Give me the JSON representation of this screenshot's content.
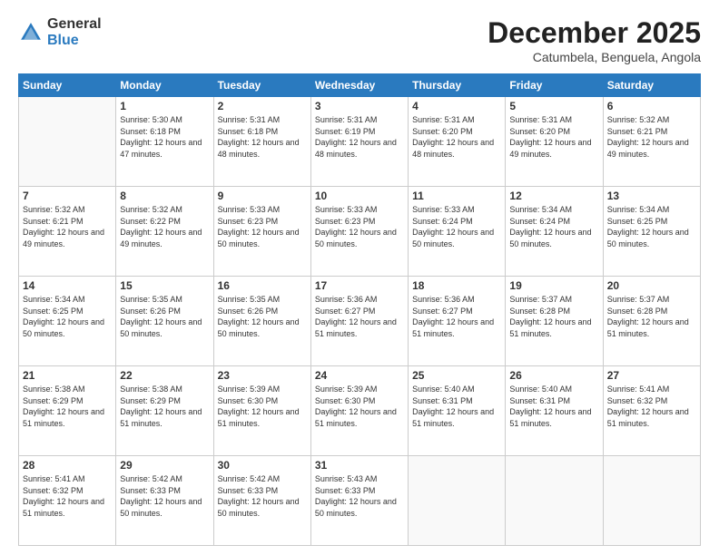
{
  "logo": {
    "general": "General",
    "blue": "Blue"
  },
  "header": {
    "month": "December 2025",
    "location": "Catumbela, Benguela, Angola"
  },
  "days": [
    "Sunday",
    "Monday",
    "Tuesday",
    "Wednesday",
    "Thursday",
    "Friday",
    "Saturday"
  ],
  "weeks": [
    [
      {
        "num": "",
        "sunrise": "",
        "sunset": "",
        "daylight": ""
      },
      {
        "num": "1",
        "sunrise": "Sunrise: 5:30 AM",
        "sunset": "Sunset: 6:18 PM",
        "daylight": "Daylight: 12 hours and 47 minutes."
      },
      {
        "num": "2",
        "sunrise": "Sunrise: 5:31 AM",
        "sunset": "Sunset: 6:18 PM",
        "daylight": "Daylight: 12 hours and 48 minutes."
      },
      {
        "num": "3",
        "sunrise": "Sunrise: 5:31 AM",
        "sunset": "Sunset: 6:19 PM",
        "daylight": "Daylight: 12 hours and 48 minutes."
      },
      {
        "num": "4",
        "sunrise": "Sunrise: 5:31 AM",
        "sunset": "Sunset: 6:20 PM",
        "daylight": "Daylight: 12 hours and 48 minutes."
      },
      {
        "num": "5",
        "sunrise": "Sunrise: 5:31 AM",
        "sunset": "Sunset: 6:20 PM",
        "daylight": "Daylight: 12 hours and 49 minutes."
      },
      {
        "num": "6",
        "sunrise": "Sunrise: 5:32 AM",
        "sunset": "Sunset: 6:21 PM",
        "daylight": "Daylight: 12 hours and 49 minutes."
      }
    ],
    [
      {
        "num": "7",
        "sunrise": "Sunrise: 5:32 AM",
        "sunset": "Sunset: 6:21 PM",
        "daylight": "Daylight: 12 hours and 49 minutes."
      },
      {
        "num": "8",
        "sunrise": "Sunrise: 5:32 AM",
        "sunset": "Sunset: 6:22 PM",
        "daylight": "Daylight: 12 hours and 49 minutes."
      },
      {
        "num": "9",
        "sunrise": "Sunrise: 5:33 AM",
        "sunset": "Sunset: 6:23 PM",
        "daylight": "Daylight: 12 hours and 50 minutes."
      },
      {
        "num": "10",
        "sunrise": "Sunrise: 5:33 AM",
        "sunset": "Sunset: 6:23 PM",
        "daylight": "Daylight: 12 hours and 50 minutes."
      },
      {
        "num": "11",
        "sunrise": "Sunrise: 5:33 AM",
        "sunset": "Sunset: 6:24 PM",
        "daylight": "Daylight: 12 hours and 50 minutes."
      },
      {
        "num": "12",
        "sunrise": "Sunrise: 5:34 AM",
        "sunset": "Sunset: 6:24 PM",
        "daylight": "Daylight: 12 hours and 50 minutes."
      },
      {
        "num": "13",
        "sunrise": "Sunrise: 5:34 AM",
        "sunset": "Sunset: 6:25 PM",
        "daylight": "Daylight: 12 hours and 50 minutes."
      }
    ],
    [
      {
        "num": "14",
        "sunrise": "Sunrise: 5:34 AM",
        "sunset": "Sunset: 6:25 PM",
        "daylight": "Daylight: 12 hours and 50 minutes."
      },
      {
        "num": "15",
        "sunrise": "Sunrise: 5:35 AM",
        "sunset": "Sunset: 6:26 PM",
        "daylight": "Daylight: 12 hours and 50 minutes."
      },
      {
        "num": "16",
        "sunrise": "Sunrise: 5:35 AM",
        "sunset": "Sunset: 6:26 PM",
        "daylight": "Daylight: 12 hours and 50 minutes."
      },
      {
        "num": "17",
        "sunrise": "Sunrise: 5:36 AM",
        "sunset": "Sunset: 6:27 PM",
        "daylight": "Daylight: 12 hours and 51 minutes."
      },
      {
        "num": "18",
        "sunrise": "Sunrise: 5:36 AM",
        "sunset": "Sunset: 6:27 PM",
        "daylight": "Daylight: 12 hours and 51 minutes."
      },
      {
        "num": "19",
        "sunrise": "Sunrise: 5:37 AM",
        "sunset": "Sunset: 6:28 PM",
        "daylight": "Daylight: 12 hours and 51 minutes."
      },
      {
        "num": "20",
        "sunrise": "Sunrise: 5:37 AM",
        "sunset": "Sunset: 6:28 PM",
        "daylight": "Daylight: 12 hours and 51 minutes."
      }
    ],
    [
      {
        "num": "21",
        "sunrise": "Sunrise: 5:38 AM",
        "sunset": "Sunset: 6:29 PM",
        "daylight": "Daylight: 12 hours and 51 minutes."
      },
      {
        "num": "22",
        "sunrise": "Sunrise: 5:38 AM",
        "sunset": "Sunset: 6:29 PM",
        "daylight": "Daylight: 12 hours and 51 minutes."
      },
      {
        "num": "23",
        "sunrise": "Sunrise: 5:39 AM",
        "sunset": "Sunset: 6:30 PM",
        "daylight": "Daylight: 12 hours and 51 minutes."
      },
      {
        "num": "24",
        "sunrise": "Sunrise: 5:39 AM",
        "sunset": "Sunset: 6:30 PM",
        "daylight": "Daylight: 12 hours and 51 minutes."
      },
      {
        "num": "25",
        "sunrise": "Sunrise: 5:40 AM",
        "sunset": "Sunset: 6:31 PM",
        "daylight": "Daylight: 12 hours and 51 minutes."
      },
      {
        "num": "26",
        "sunrise": "Sunrise: 5:40 AM",
        "sunset": "Sunset: 6:31 PM",
        "daylight": "Daylight: 12 hours and 51 minutes."
      },
      {
        "num": "27",
        "sunrise": "Sunrise: 5:41 AM",
        "sunset": "Sunset: 6:32 PM",
        "daylight": "Daylight: 12 hours and 51 minutes."
      }
    ],
    [
      {
        "num": "28",
        "sunrise": "Sunrise: 5:41 AM",
        "sunset": "Sunset: 6:32 PM",
        "daylight": "Daylight: 12 hours and 51 minutes."
      },
      {
        "num": "29",
        "sunrise": "Sunrise: 5:42 AM",
        "sunset": "Sunset: 6:33 PM",
        "daylight": "Daylight: 12 hours and 50 minutes."
      },
      {
        "num": "30",
        "sunrise": "Sunrise: 5:42 AM",
        "sunset": "Sunset: 6:33 PM",
        "daylight": "Daylight: 12 hours and 50 minutes."
      },
      {
        "num": "31",
        "sunrise": "Sunrise: 5:43 AM",
        "sunset": "Sunset: 6:33 PM",
        "daylight": "Daylight: 12 hours and 50 minutes."
      },
      {
        "num": "",
        "sunrise": "",
        "sunset": "",
        "daylight": ""
      },
      {
        "num": "",
        "sunrise": "",
        "sunset": "",
        "daylight": ""
      },
      {
        "num": "",
        "sunrise": "",
        "sunset": "",
        "daylight": ""
      }
    ]
  ]
}
